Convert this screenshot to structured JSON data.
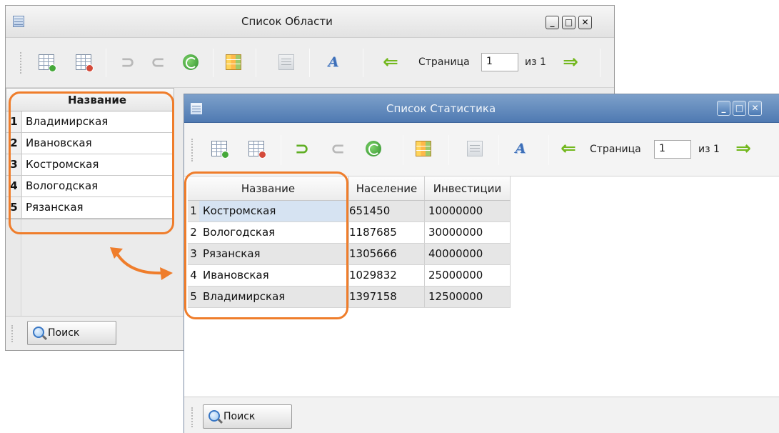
{
  "window1": {
    "title": "Список Области",
    "controls": {
      "minimize": "_",
      "maximize": "□",
      "close": "✕"
    },
    "toolbar": {
      "page_label": "Страница",
      "page_value": "1",
      "page_of": "из 1"
    },
    "grid": {
      "header": "Название",
      "rows": [
        {
          "num": "1",
          "name": "Владимирская"
        },
        {
          "num": "2",
          "name": "Ивановская"
        },
        {
          "num": "3",
          "name": "Костромская"
        },
        {
          "num": "4",
          "name": "Вологодская"
        },
        {
          "num": "5",
          "name": "Рязанская"
        }
      ]
    },
    "search_label": "Поиск"
  },
  "window2": {
    "title": "Список Статистика",
    "controls": {
      "minimize": "_",
      "maximize": "□",
      "close": "✕"
    },
    "toolbar": {
      "page_label": "Страница",
      "page_value": "1",
      "page_of": "из 1"
    },
    "grid": {
      "headers": [
        "Название",
        "Население",
        "Инвестиции"
      ],
      "rows": [
        {
          "num": "1",
          "name": "Костромская",
          "population": "651450",
          "investments": "10000000"
        },
        {
          "num": "2",
          "name": "Вологодская",
          "population": "1187685",
          "investments": "30000000"
        },
        {
          "num": "3",
          "name": "Рязанская",
          "population": "1305666",
          "investments": "40000000"
        },
        {
          "num": "4",
          "name": "Ивановская",
          "population": "1029832",
          "investments": "25000000"
        },
        {
          "num": "5",
          "name": "Владимирская",
          "population": "1397158",
          "investments": "12500000"
        }
      ]
    },
    "search_label": "Поиск"
  },
  "icons": {
    "add": "add-row-icon",
    "delete": "delete-row-icon",
    "undo": "undo-icon",
    "redo": "redo-icon",
    "refresh": "refresh-icon",
    "table": "table-icon",
    "export": "export-icon",
    "text": "text-format-icon",
    "prev": "arrow-left-icon",
    "next": "arrow-right-icon",
    "search": "magnifier-icon"
  },
  "colors": {
    "highlight": "#ef7d2b",
    "active_titlebar": "#5a83b8",
    "nav_arrow": "#73b81e"
  }
}
